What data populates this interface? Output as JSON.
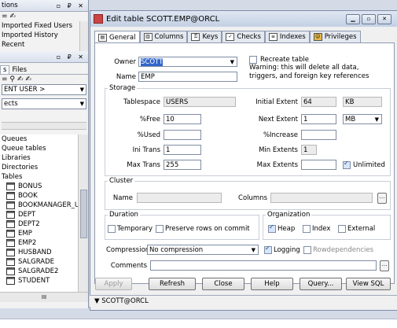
{
  "left_panel": {
    "top_title": "tions",
    "recent_items": [
      "Imported Fixed Users",
      "Imported History",
      "Recent"
    ],
    "tabs_prefix": "s",
    "files_tab": "Files",
    "user_dropdown": "ENT USER >",
    "objects_dropdown": "ects",
    "tree_items": [
      "Queues",
      "Queue tables",
      "Libraries",
      "Directories",
      "Tables"
    ],
    "tables": [
      "BONUS",
      "BOOK",
      "BOOKMANAGER_U",
      "DEPT",
      "DEPT2",
      "EMP",
      "EMP2",
      "HUSBAND",
      "SALGRADE",
      "SALGRADE2",
      "STUDENT"
    ],
    "scroll_label": "III"
  },
  "window": {
    "title": "Edit table SCOTT.EMP@ORCL",
    "tabs": [
      "General",
      "Columns",
      "Keys",
      "Checks",
      "Indexes",
      "Privileges"
    ],
    "owner_label": "Owner",
    "owner_value": "SCOTT",
    "name_label": "Name",
    "name_value": "EMP",
    "recreate_label": "Recreate table",
    "warning": "Warning: this will delete all data, triggers, and foreign key references",
    "storage": {
      "title": "Storage",
      "tablespace_label": "Tablespace",
      "tablespace_value": "USERS",
      "initial_extent_label": "Initial Extent",
      "initial_extent_value": "64",
      "initial_extent_unit": "KB",
      "pctfree_label": "%Free",
      "pctfree_value": "10",
      "next_extent_label": "Next Extent",
      "next_extent_value": "1",
      "next_extent_unit": "MB",
      "pctused_label": "%Used",
      "pctincrease_label": "%Increase",
      "initrans_label": "Ini Trans",
      "initrans_value": "1",
      "min_extents_label": "Min Extents",
      "min_extents_value": "1",
      "maxtrans_label": "Max Trans",
      "maxtrans_value": "255",
      "max_extents_label": "Max Extents",
      "unlimited_label": "Unlimited"
    },
    "cluster": {
      "title": "Cluster",
      "name_label": "Name",
      "columns_label": "Columns"
    },
    "duration": {
      "title": "Duration",
      "temporary_label": "Temporary",
      "preserve_label": "Preserve rows on commit"
    },
    "organization": {
      "title": "Organization",
      "heap_label": "Heap",
      "index_label": "Index",
      "external_label": "External"
    },
    "compression_label": "Compression",
    "compression_value": "No compression",
    "logging_label": "Logging",
    "rowdependencies_label": "Rowdependencies",
    "comments_label": "Comments",
    "buttons": {
      "apply": "Apply",
      "refresh": "Refresh",
      "close": "Close",
      "help": "Help",
      "query": "Query...",
      "view_sql": "View SQL"
    },
    "status": "SCOTT@ORCL"
  }
}
